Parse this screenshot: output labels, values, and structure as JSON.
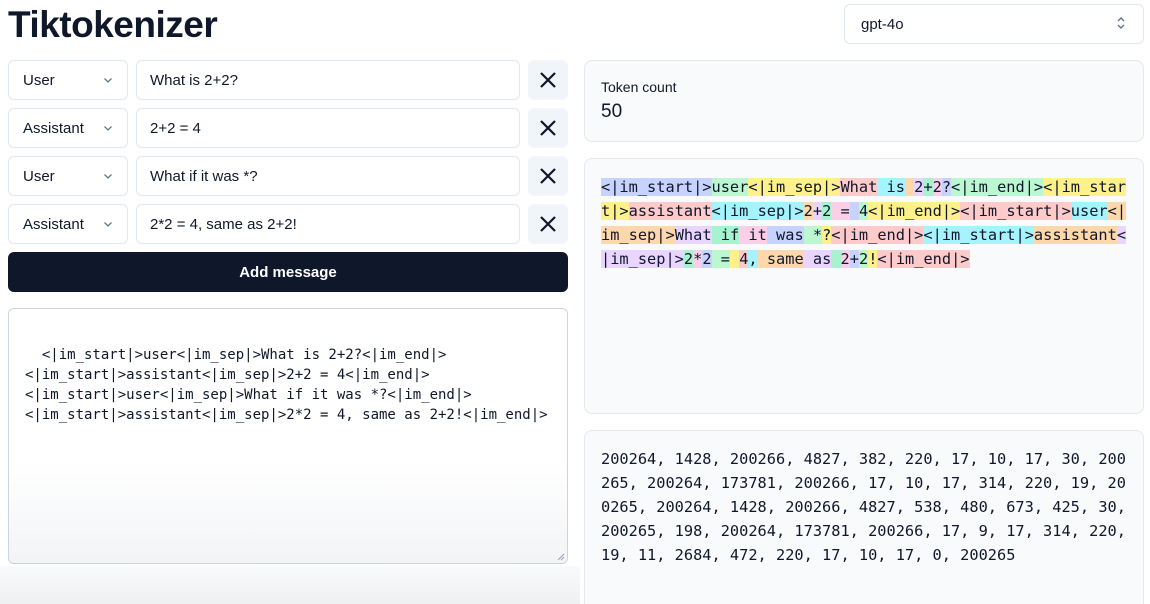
{
  "app": {
    "title": "Tiktokenizer"
  },
  "model": {
    "selected": "gpt-4o"
  },
  "messages": [
    {
      "role": "User",
      "content": "What is 2+2?"
    },
    {
      "role": "Assistant",
      "content": "2+2 = 4"
    },
    {
      "role": "User",
      "content": "What if it was *?"
    },
    {
      "role": "Assistant",
      "content": "2*2 = 4, same as 2+2!"
    }
  ],
  "actions": {
    "add_message": "Add message"
  },
  "prompt_text": "<|im_start|>user<|im_sep|>What is 2+2?<|im_end|>\n<|im_start|>assistant<|im_sep|>2+2 = 4<|im_end|>\n<|im_start|>user<|im_sep|>What if it was *?<|im_end|>\n<|im_start|>assistant<|im_sep|>2*2 = 4, same as 2+2!<|im_end|>",
  "token_count": {
    "label": "Token count",
    "value": "50"
  },
  "token_colors": [
    "#c7d2fe",
    "#bbf7d0",
    "#fef08a",
    "#fecaca",
    "#a5f3fc",
    "#fed7aa",
    "#e9d5ff",
    "#a7f3d0",
    "#fbcfe8"
  ],
  "tokens": [
    "<|im_start|>",
    "user",
    "<|im_sep|>",
    "What",
    " is",
    " ",
    "2",
    "+",
    "2",
    "?",
    "<|im_end|>",
    "<|im_start|>",
    "assistant",
    "<|im_sep|>",
    "2",
    "+",
    "2",
    " =",
    " ",
    "4",
    "<|im_end|>",
    "<|im_start|>",
    "user",
    "<|im_sep|>",
    "What",
    " if",
    " it",
    " was",
    " *",
    "?",
    "<|im_end|>",
    "<|im_start|>",
    "assistant",
    "<|im_sep|>",
    "2",
    "*",
    "2",
    " =",
    " ",
    "4",
    ",",
    " same",
    " as",
    " ",
    "2",
    "+",
    "2",
    "!",
    "<|im_end|>"
  ],
  "token_ids_text": "200264, 1428, 200266, 4827, 382, 220, 17, 10, 17, 30, 200265, 200264, 173781, 200266, 17, 10, 17, 314, 220, 19, 200265, 200264, 1428, 200266, 4827, 538, 480, 673, 425, 30, 200265, 198, 200264, 173781, 200266, 17, 9, 17, 314, 220, 19, 11, 2684, 472, 220, 17, 10, 17, 0, 200265"
}
